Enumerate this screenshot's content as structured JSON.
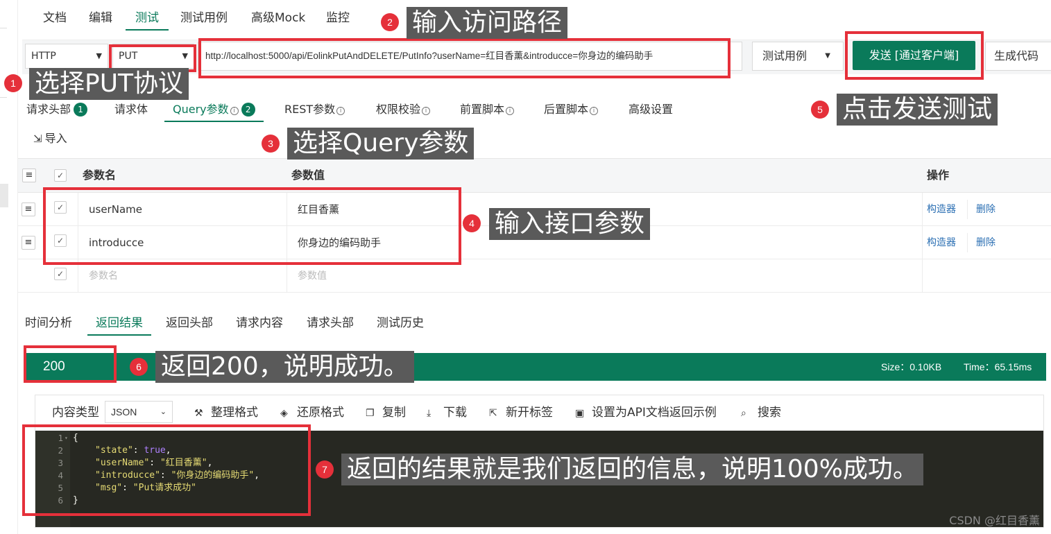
{
  "top_tabs": [
    "文档",
    "编辑",
    "测试",
    "测试用例",
    "高级Mock",
    "监控"
  ],
  "request": {
    "protocol": "HTTP",
    "method": "PUT",
    "url": "http://localhost:5000/api/EolinkPutAndDELETE/PutInfo?userName=红目香薰&introducce=你身边的编码助手",
    "test_case_label": "测试用例",
    "send_label": "发送 [通过客户端]",
    "gen_code_label": "生成代码"
  },
  "sub_tabs": {
    "headers": {
      "label": "请求头部",
      "badge": "1"
    },
    "body": {
      "label": "请求体"
    },
    "query": {
      "label": "Query参数",
      "badge": "2"
    },
    "rest": {
      "label": "REST参数"
    },
    "auth": {
      "label": "权限校验"
    },
    "pre_script": {
      "label": "前置脚本"
    },
    "post_script": {
      "label": "后置脚本"
    },
    "advanced": {
      "label": "高级设置"
    }
  },
  "import_label": "导入",
  "params_table": {
    "headers": {
      "name": "参数名",
      "value": "参数值",
      "actions": "操作"
    },
    "rows": [
      {
        "name": "userName",
        "value": "红目香薰",
        "checked": true
      },
      {
        "name": "introducce",
        "value": "你身边的编码助手",
        "checked": true
      }
    ],
    "placeholder_name": "参数名",
    "placeholder_value": "参数值",
    "action_build": "构造器",
    "action_delete": "删除"
  },
  "response_tabs": [
    "时间分析",
    "返回结果",
    "返回头部",
    "请求内容",
    "请求头部",
    "测试历史"
  ],
  "status": {
    "code": "200",
    "size": "Size：0.10KB",
    "time": "Time：65.15ms"
  },
  "toolbar": {
    "content_type_label": "内容类型",
    "content_type_value": "JSON",
    "format": "整理格式",
    "restore": "还原格式",
    "copy": "复制",
    "download": "下载",
    "new_tab": "新开标签",
    "set_example": "设置为API文档返回示例",
    "search": "搜索"
  },
  "code": {
    "line_numbers": [
      "1",
      "2",
      "3",
      "4",
      "5",
      "6"
    ],
    "open_brace": "{",
    "close_brace": "}",
    "entries": [
      {
        "key": "\"state\"",
        "value": "true",
        "comma": ","
      },
      {
        "key": "\"userName\"",
        "value": "\"红目香薰\"",
        "comma": ","
      },
      {
        "key": "\"introducce\"",
        "value": "\"你身边的编码助手\"",
        "comma": ","
      },
      {
        "key": "\"msg\"",
        "value": "\"Put请求成功\"",
        "comma": ""
      }
    ]
  },
  "annotations": [
    {
      "num": "1",
      "text": "选择PUT协议"
    },
    {
      "num": "2",
      "text": "输入访问路径"
    },
    {
      "num": "3",
      "text": "选择Query参数"
    },
    {
      "num": "4",
      "text": "输入接口参数"
    },
    {
      "num": "5",
      "text": "点击发送测试"
    },
    {
      "num": "6",
      "text": "返回200，说明成功。"
    },
    {
      "num": "7",
      "text": "返回的结果就是我们返回的信息，说明100%成功。"
    }
  ],
  "watermark": "CSDN @红目香薰",
  "colors": {
    "accent": "#0a7a5a",
    "annotation_red": "#e5303a",
    "label_gray": "#5a5a5a",
    "editor_bg": "#272822"
  }
}
